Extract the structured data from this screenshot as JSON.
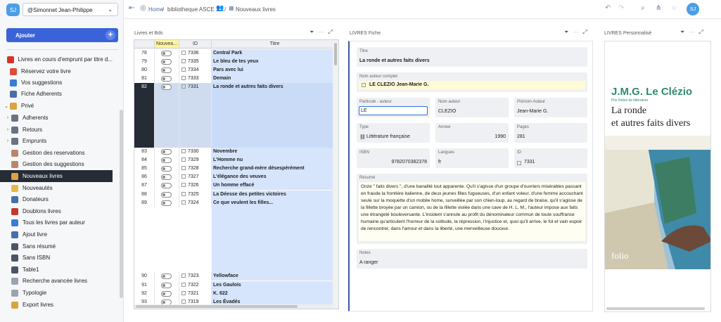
{
  "sidebar": {
    "badge": "SJ",
    "user": "@Simonnet Jean-Philippe",
    "add_label": "Ajouter",
    "items": [
      {
        "label": "Livres en cours d'emprunt par titre d...",
        "color": "#d8332a",
        "arrow": ""
      },
      {
        "label": "Réservez votre livre",
        "color": "#e04a3a",
        "arrow": ""
      },
      {
        "label": "Vos suggestions",
        "color": "#3a7bd5",
        "arrow": ""
      },
      {
        "label": "Fiche Adherents",
        "color": "#4a6ea8",
        "arrow": ""
      },
      {
        "label": "Privé",
        "color": "#d9a441",
        "arrow": "⌄"
      },
      {
        "label": "Adherents",
        "color": "#6b7280",
        "arrow": "›"
      },
      {
        "label": "Retours",
        "color": "#6b7280",
        "arrow": "›"
      },
      {
        "label": "Emprunts",
        "color": "#6b7280",
        "arrow": "›"
      },
      {
        "label": "Gestion des reservations",
        "color": "#b8866b",
        "arrow": ""
      },
      {
        "label": "Gestion des suggestions",
        "color": "#b8866b",
        "arrow": ""
      },
      {
        "label": "Nouveaux livres",
        "color": "#d9a441",
        "arrow": ""
      },
      {
        "label": "Nouveautés",
        "color": "#e6b84a",
        "arrow": ""
      },
      {
        "label": "Donateurs",
        "color": "#4a6ea8",
        "arrow": ""
      },
      {
        "label": "Doublons livres",
        "color": "#c0392b",
        "arrow": ""
      },
      {
        "label": "Tous les livres par auteur",
        "color": "#3a7bd5",
        "arrow": ""
      },
      {
        "label": "Ajout livre",
        "color": "#4a6ea8",
        "arrow": ""
      },
      {
        "label": "Sans résumé",
        "color": "#4b5563",
        "arrow": ""
      },
      {
        "label": "Sans ISBN",
        "color": "#4b5563",
        "arrow": ""
      },
      {
        "label": "Table1",
        "color": "#4b5563",
        "arrow": ""
      },
      {
        "label": "Recherche avancée livres",
        "color": "#9ca3af",
        "arrow": ""
      },
      {
        "label": "Typologie",
        "color": "#9ca3af",
        "arrow": ""
      },
      {
        "label": "Export livres",
        "color": "#d9a441",
        "arrow": ""
      }
    ]
  },
  "topbar": {
    "home": "Home",
    "sep1": "/",
    "db": "bibliotheque ASCE",
    "sep2": "/",
    "page": "Nouveaux livres"
  },
  "avatar": "SJ",
  "grid": {
    "title": "Livres et Bds",
    "headers": {
      "toggle": "Nouvea...",
      "id": "ID",
      "title": "Titre"
    },
    "rows": [
      {
        "num": "78",
        "id": "7336",
        "title": "Central Park"
      },
      {
        "num": "79",
        "id": "7335",
        "title": "Le bleu de tes yeux"
      },
      {
        "num": "80",
        "id": "7334",
        "title": "Pars avec lui"
      },
      {
        "num": "81",
        "id": "7333",
        "title": "Demain"
      },
      {
        "num": "82",
        "id": "7331",
        "title": "La ronde et autres faits divers"
      },
      {
        "num": "83",
        "id": "7330",
        "title": "Novembre"
      },
      {
        "num": "84",
        "id": "7329",
        "title": "L'Homme nu"
      },
      {
        "num": "85",
        "id": "7328",
        "title": "Recherche grand-mère désespérément"
      },
      {
        "num": "86",
        "id": "7327",
        "title": "L'élégance des veuves"
      },
      {
        "num": "87",
        "id": "7326",
        "title": "Un homme effacé"
      },
      {
        "num": "88",
        "id": "7325",
        "title": "La Déesse des petites victoires"
      },
      {
        "num": "89",
        "id": "7324",
        "title": "Ce que veulent les filles..."
      },
      {
        "num": "90",
        "id": "7323",
        "title": "Yellowface"
      },
      {
        "num": "91",
        "id": "7322",
        "title": "Les Gaulois"
      },
      {
        "num": "92",
        "id": "7321",
        "title": "K. 622"
      },
      {
        "num": "93",
        "id": "7319",
        "title": "Les Évadés"
      }
    ]
  },
  "form": {
    "title": "LIVRES Fiche",
    "fields": {
      "titre": {
        "label": "Titre",
        "value": "La ronde et autres faits divers"
      },
      "nom_complet": {
        "label": "Nom auteur complet",
        "value": "LE CLEZIO Jean-Marie G."
      },
      "particule": {
        "label": "Particule - auteur",
        "value": "LE"
      },
      "nom": {
        "label": "Nom auteur",
        "value": "CLEZIO"
      },
      "prenom": {
        "label": "Prénom Auteur",
        "value": "Jean-Marie G."
      },
      "type": {
        "label": "Type",
        "value": "Littérature française"
      },
      "annee": {
        "label": "Annee",
        "value": "1990"
      },
      "pages": {
        "label": "Pages",
        "value": "281"
      },
      "isbn": {
        "label": "ISBN",
        "value": "9782070382378"
      },
      "langues": {
        "label": "Langues",
        "value": "fr"
      },
      "id": {
        "label": "ID",
        "value": "7331"
      },
      "resume": {
        "label": "Résumé",
        "value": "Onze \" faits divers \", d'une banalité tout apparente. Qu'il s'agisse d'un groupe d'ouvriers misérables passant en fraude la frontière italienne, de deux jeunes filles fugueuses, d'un enfant voleur, d'une femme accouchant seule sur la moquette d'un mobile home, surveillée par son chien-loup, au regard de braise, qu'il s'agisse de la fillette broyée par un camion, ou de la fillette violée dans une cave de H. L. M., l'auteur impose aux faits une étrangeté bouleversante. L'incident s'annule au profit du dénominateur commun de toute souffrance humaine qu'articulent l'horreur de la solitude, la répression, l'injustice et, quoi qu'il arrive, le fol et vain espoir de rencontrer, dans l'amour et dans la liberté, une merveilleuse douceur."
      },
      "notes": {
        "label": "Notes",
        "value": "A ranger"
      }
    }
  },
  "cover": {
    "panel_title": "LIVRES Personnalisé",
    "author": "J.M.G. Le Clézio",
    "prize": "Prix Nobel de littérature",
    "title_line1": "La ronde",
    "title_line2": "et autres faits divers",
    "publisher": "folio"
  },
  "colors": {
    "accent": "#3b63d9",
    "active_bg": "#262c35",
    "selected_row": "#d6e5fb",
    "cover_green": "#2e8b6e"
  }
}
